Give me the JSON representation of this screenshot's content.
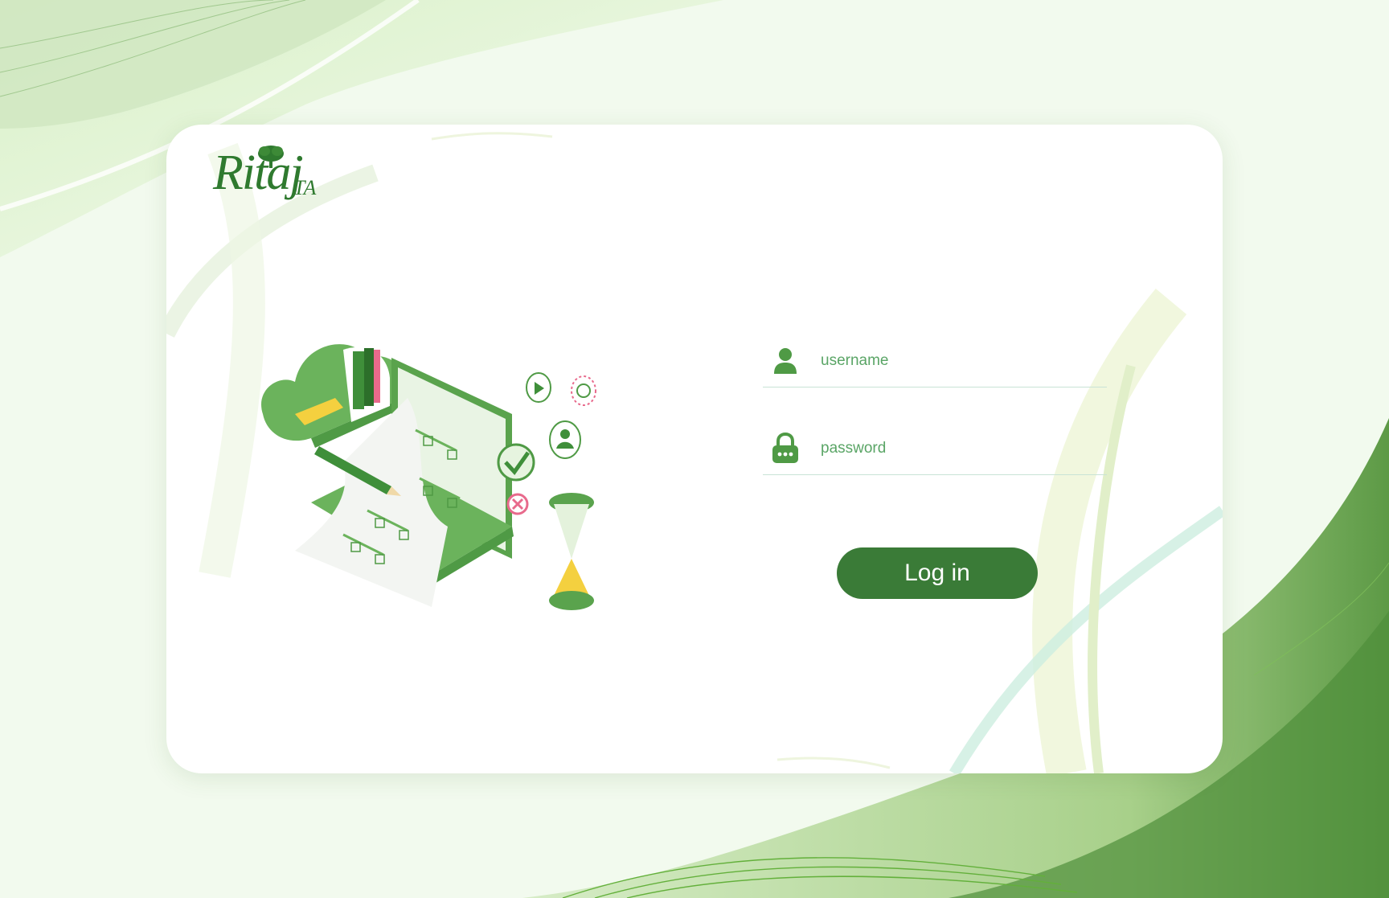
{
  "brand": {
    "name": "Ritaj",
    "suffix": "TA"
  },
  "login": {
    "username_placeholder": "username",
    "username_value": "",
    "password_placeholder": "password",
    "password_value": "",
    "submit_label": "Log in"
  },
  "icons": {
    "username": "user-icon",
    "password": "lock-icon"
  },
  "colors": {
    "primary": "#3a7b37",
    "accent_text": "#5aa566",
    "background": "#eef7e6",
    "field_underline": "#c9e3d6"
  }
}
